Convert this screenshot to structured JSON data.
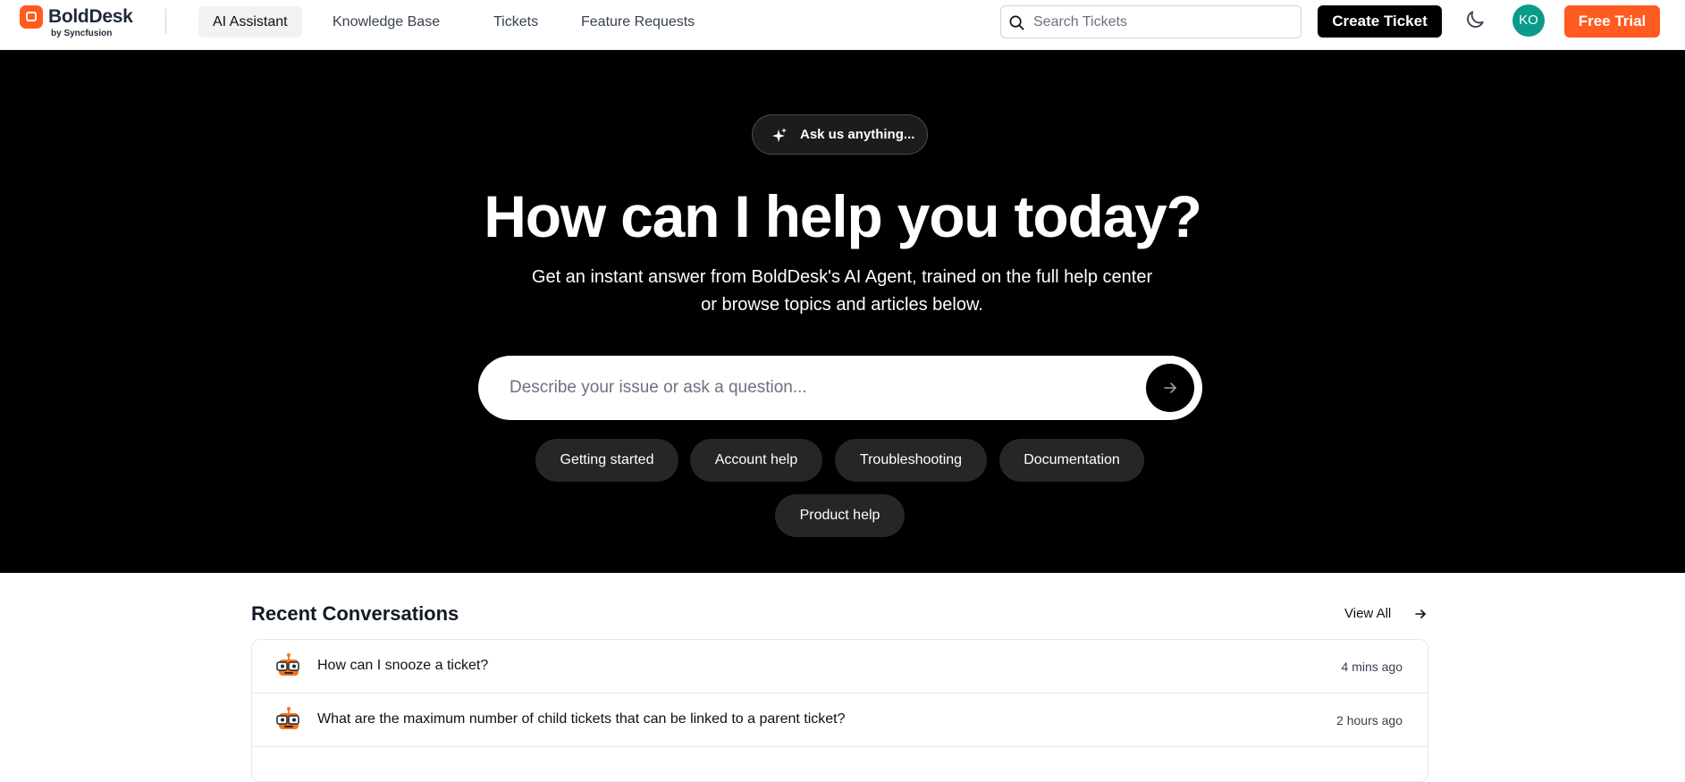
{
  "brand": {
    "name": "BoldDesk",
    "sub": "by Syncfusion"
  },
  "nav": {
    "items": [
      {
        "label": "AI Assistant"
      },
      {
        "label": "Knowledge Base"
      },
      {
        "label": "Tickets"
      },
      {
        "label": "Feature Requests"
      }
    ]
  },
  "header": {
    "search_placeholder": "Search Tickets",
    "create_ticket": "Create Ticket",
    "avatar_initials": "KO",
    "free_trial": "Free Trial"
  },
  "hero": {
    "pill": "Ask us anything...",
    "title": "How can I help you today?",
    "subtitle_line1": "Get an instant answer from BoldDesk's AI Agent, trained on the full help center",
    "subtitle_line2": "or browse topics and articles below.",
    "input_placeholder": "Describe your issue or ask a question...",
    "chips": [
      {
        "label": "Getting started"
      },
      {
        "label": "Account help"
      },
      {
        "label": "Troubleshooting"
      },
      {
        "label": "Documentation"
      },
      {
        "label": "Product help"
      }
    ]
  },
  "recent": {
    "title": "Recent Conversations",
    "view_all": "View All",
    "items": [
      {
        "question": "How can I snooze a ticket?",
        "time": "4 mins ago"
      },
      {
        "question": "What are the maximum number of child tickets that can be linked to a parent ticket?",
        "time": "2 hours ago"
      }
    ]
  },
  "colors": {
    "accent": "#ff5a1f",
    "avatar": "#0b9b8a",
    "hero_bg": "#000000"
  }
}
